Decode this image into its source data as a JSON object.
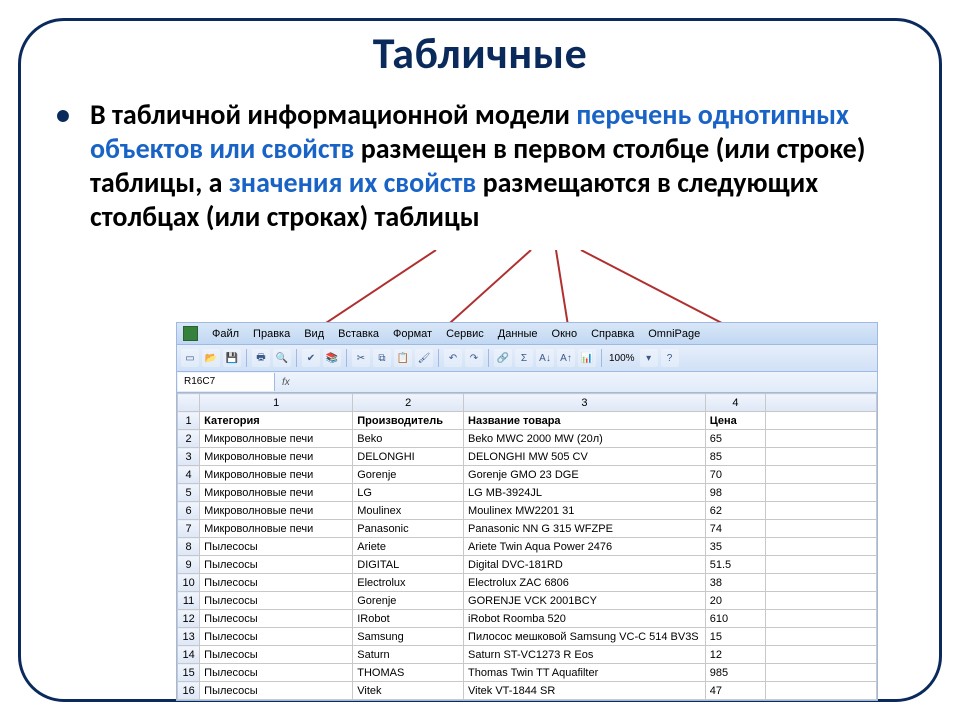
{
  "title": "Табличные",
  "bullet_parts": {
    "p1": "В табличной информационной модели ",
    "h1": "перечень однотипных объектов или свойств",
    "p2": " размещен в первом столбце (или строке) таблицы, а ",
    "h2": "значения их свойств",
    "p3": " размещаются в следующих столбцах  (или строках) таблицы"
  },
  "menu": [
    "Файл",
    "Правка",
    "Вид",
    "Вставка",
    "Формат",
    "Сервис",
    "Данные",
    "Окно",
    "Справка",
    "OmniPage"
  ],
  "zoom": "100%",
  "namebox": "R16C7",
  "fx_label": "fx",
  "col_headers": [
    "1",
    "2",
    "3",
    "4"
  ],
  "header_row": [
    "Категория",
    "Производитель",
    "Название товара",
    "Цена"
  ],
  "rows": [
    [
      "Микроволновые печи",
      "Beko",
      "Beko MWC 2000 MW (20л)",
      "65"
    ],
    [
      "Микроволновые печи",
      "DELONGHI",
      "DELONGHI MW 505 CV",
      "85"
    ],
    [
      "Микроволновые печи",
      "Gorenje",
      "Gorenje GMO 23 DGE",
      "70"
    ],
    [
      "Микроволновые печи",
      "LG",
      "LG MB-3924JL",
      "98"
    ],
    [
      "Микроволновые печи",
      "Moulinex",
      "Moulinex MW2201 31",
      "62"
    ],
    [
      "Микроволновые печи",
      "Panasonic",
      "Panasonic NN G 315 WFZPE",
      "74"
    ],
    [
      "Пылесосы",
      "Ariete",
      "Ariete Twin Aqua Power 2476",
      "35"
    ],
    [
      "Пылесосы",
      "DIGITAL",
      "Digital DVC-181RD",
      "51.5"
    ],
    [
      "Пылесосы",
      "Electrolux",
      "Electrolux ZAC 6806",
      "38"
    ],
    [
      "Пылесосы",
      "Gorenje",
      "GORENJE VCK 2001BCY",
      "20"
    ],
    [
      "Пылесосы",
      "IRobot",
      "iRobot Roomba 520",
      "610"
    ],
    [
      "Пылесосы",
      "Samsung",
      "Пилосос мешковой Samsung VC-C 514 BV3S",
      "15"
    ],
    [
      "Пылесосы",
      "Saturn",
      "Saturn ST-VC1273 R Eos",
      "12"
    ],
    [
      "Пылесосы",
      "THOMAS",
      "Thomas Twin TT Aquafilter",
      "985"
    ],
    [
      "Пылесосы",
      "Vitek",
      "Vitek VT-1844 SR",
      "47"
    ]
  ],
  "chart_data": {
    "type": "table",
    "title": "Табличные",
    "columns": [
      "Категория",
      "Производитель",
      "Название товара",
      "Цена"
    ],
    "rows": [
      [
        "Микроволновые печи",
        "Beko",
        "Beko MWC 2000 MW (20л)",
        65
      ],
      [
        "Микроволновые печи",
        "DELONGHI",
        "DELONGHI MW 505 CV",
        85
      ],
      [
        "Микроволновые печи",
        "Gorenje",
        "Gorenje GMO 23 DGE",
        70
      ],
      [
        "Микроволновые печи",
        "LG",
        "LG MB-3924JL",
        98
      ],
      [
        "Микроволновые печи",
        "Moulinex",
        "Moulinex MW2201 31",
        62
      ],
      [
        "Микроволновые печи",
        "Panasonic",
        "Panasonic NN G 315 WFZPE",
        74
      ],
      [
        "Пылесосы",
        "Ariete",
        "Ariete Twin Aqua Power 2476",
        35
      ],
      [
        "Пылесосы",
        "DIGITAL",
        "Digital DVC-181RD",
        51.5
      ],
      [
        "Пылесосы",
        "Electrolux",
        "Electrolux ZAC 6806",
        38
      ],
      [
        "Пылесосы",
        "Gorenje",
        "GORENJE VCK 2001BCY",
        20
      ],
      [
        "Пылесосы",
        "IRobot",
        "iRobot Roomba 520",
        610
      ],
      [
        "Пылесосы",
        "Samsung",
        "Пилосос мешковой Samsung VC-C 514 BV3S",
        15
      ],
      [
        "Пылесосы",
        "Saturn",
        "Saturn ST-VC1273 R Eos",
        12
      ],
      [
        "Пылесосы",
        "THOMAS",
        "Thomas Twin TT Aquafilter",
        985
      ],
      [
        "Пылесосы",
        "Vitek",
        "Vitek VT-1844 SR",
        47
      ]
    ]
  }
}
